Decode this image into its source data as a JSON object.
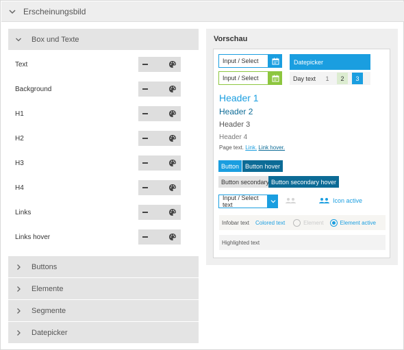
{
  "topbar": {
    "title": "Erscheinungsbild"
  },
  "left": {
    "open_section": {
      "label": "Box und Texte"
    },
    "rows": [
      {
        "label": "Text"
      },
      {
        "label": "Background"
      },
      {
        "label": "H1"
      },
      {
        "label": "H2"
      },
      {
        "label": "H3"
      },
      {
        "label": "H4"
      },
      {
        "label": "Links"
      },
      {
        "label": "Links hover"
      }
    ],
    "closed_sections": [
      {
        "label": "Buttons"
      },
      {
        "label": "Elemente"
      },
      {
        "label": "Segmente"
      },
      {
        "label": "Datepicker"
      }
    ]
  },
  "preview": {
    "title": "Vorschau",
    "input1": "Input / Select",
    "input2": "Input / Select",
    "datepicker": "Datepicker",
    "day_text": "Day text",
    "days": [
      "1",
      "2",
      "3"
    ],
    "header1": "Header 1",
    "header2": "Header 2",
    "header3": "Header 3",
    "header4": "Header 4",
    "page_text": "Page text.",
    "link": "Link.",
    "link_hover": "Link hover.",
    "button": "Button",
    "button_hover": "Button hover",
    "button_secondary": "Button secondary",
    "button_secondary_hover": "Button secondary hover",
    "select_text": "Input / Select text",
    "icon_active": "Icon active",
    "infobar_text": "Infobar text",
    "colored_text": "Colored text",
    "element": "Element",
    "element_active": "Element active",
    "highlighted_text": "Highlighted text"
  },
  "colors": {
    "primary": "#1a9ee0",
    "primary_dark": "#0c6b96",
    "accent_green": "#8dc63f",
    "day2_bg": "#dcecd0",
    "day3_bg": "#1a9ee0"
  },
  "icons": {
    "topbar": "chevron-down-icon",
    "section_open": "chevron-down-icon",
    "section_closed": "chevron-right-icon",
    "row_remove": "minus-icon",
    "row_color": "palette-icon",
    "calendar": "calendar-icon",
    "select": "chevron-down-icon",
    "users": "users-icon"
  }
}
